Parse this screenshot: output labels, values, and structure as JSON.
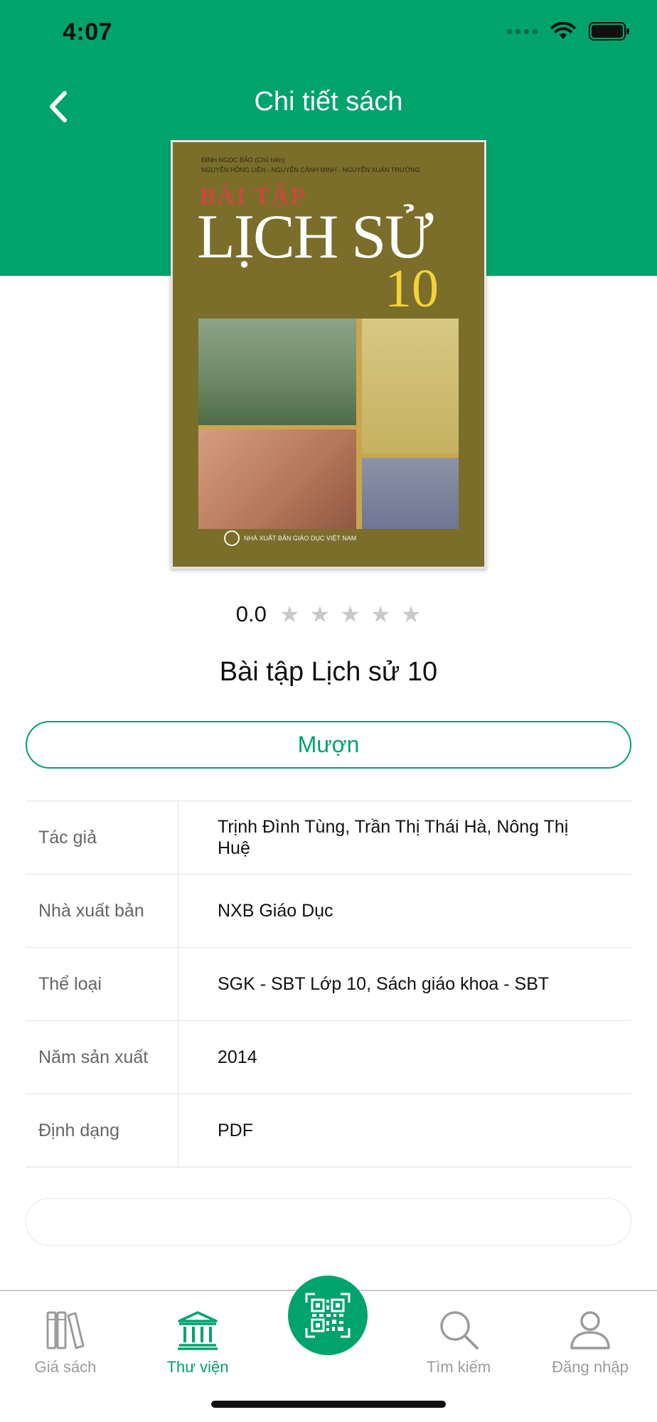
{
  "status_bar": {
    "time": "4:07"
  },
  "header": {
    "title": "Chi tiết sách"
  },
  "cover": {
    "credits_line1": "ĐINH NGỌC BẢO (Chủ biên)",
    "credits_line2": "NGUYỄN HỒNG LIÊN - NGUYỄN CẢNH MINH - NGUYỄN XUÂN TRƯỜNG",
    "subtitle": "BÀI TẬP",
    "title": "LỊCH SỬ",
    "grade": "10",
    "publisher": "NHÀ XUẤT BẢN GIÁO DỤC VIỆT NAM"
  },
  "rating": {
    "value": "0.0",
    "max_stars": 5,
    "star_color": "#c9c9c9"
  },
  "book": {
    "title": "Bài tập Lịch sử 10"
  },
  "borrow_button": {
    "label": "Mượn"
  },
  "details": [
    {
      "label": "Tác giả",
      "value": "Trịnh Đình Tùng, Trần Thị Thái Hà, Nông Thị Huệ"
    },
    {
      "label": "Nhà xuất bản",
      "value": "NXB Giáo Dục"
    },
    {
      "label": "Thể loại",
      "value": "SGK - SBT  Lớp 10, Sách giáo khoa - SBT"
    },
    {
      "label": "Năm sản xuất",
      "value": "2014"
    },
    {
      "label": "Định dạng",
      "value": "PDF"
    }
  ],
  "tabbar": {
    "items": [
      {
        "label": "Giá sách",
        "icon": "bookshelf-icon",
        "active": false
      },
      {
        "label": "Thư viện",
        "icon": "library-icon",
        "active": true
      },
      {
        "label": "",
        "icon": "qr-code-icon",
        "active": false
      },
      {
        "label": "Tìm kiếm",
        "icon": "search-icon",
        "active": false
      },
      {
        "label": "Đăng nhập",
        "icon": "user-icon",
        "active": false
      }
    ]
  },
  "colors": {
    "accent": "#00a36c",
    "inactive": "#9b9b9b"
  }
}
